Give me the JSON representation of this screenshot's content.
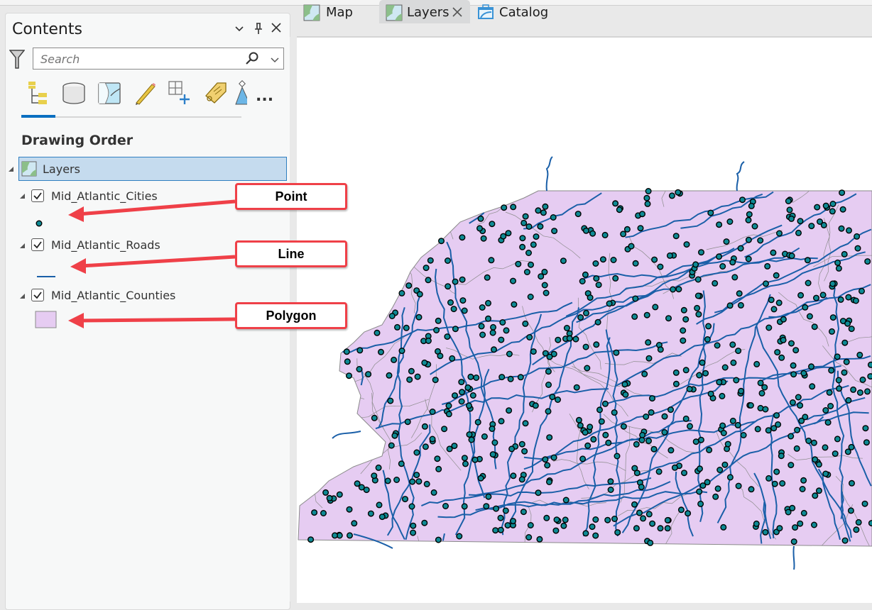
{
  "contents_pane": {
    "title": "Contents",
    "controls": {
      "options": "⌄",
      "pin": "pin",
      "close": "✕"
    },
    "search": {
      "placeholder": "Search",
      "value": ""
    },
    "toolbar": [
      {
        "icon": "list-by-drawing-order-icon",
        "selected": true
      },
      {
        "icon": "list-by-data-source-icon"
      },
      {
        "icon": "list-by-selection-icon"
      },
      {
        "icon": "list-by-editing-icon"
      },
      {
        "icon": "list-by-snapping-icon"
      },
      {
        "icon": "list-by-labeling-icon"
      },
      {
        "icon": "list-by-perspective-imagery-icon"
      },
      {
        "icon": "more-icon",
        "label": "..."
      }
    ],
    "heading": "Drawing Order",
    "map_frame": {
      "name": "Layers",
      "selected": true
    },
    "layers": [
      {
        "name": "Mid_Atlantic_Cities",
        "checked": true,
        "symbol": "point",
        "symbol_color": "#0e8a94"
      },
      {
        "name": "Mid_Atlantic_Roads",
        "checked": true,
        "symbol": "line",
        "symbol_color": "#1a5fa8"
      },
      {
        "name": "Mid_Atlantic_Counties",
        "checked": true,
        "symbol": "polygon",
        "symbol_color": "#e6ccf2"
      }
    ]
  },
  "callouts": [
    {
      "label": "Point"
    },
    {
      "label": "Line"
    },
    {
      "label": "Polygon"
    }
  ],
  "tabs": [
    {
      "label": "Map",
      "icon": "map-icon",
      "active": false
    },
    {
      "label": "Layers",
      "icon": "map-icon",
      "active": true,
      "closable": true
    },
    {
      "label": "Catalog",
      "icon": "catalog-icon",
      "active": false
    }
  ],
  "map": {
    "polygon_fill": "#e6ccf2",
    "polygon_outline": "#8a8a8a",
    "road_color": "#1a5fa8",
    "city_fill": "#0e8a94",
    "city_outline": "#000000"
  },
  "colors": {
    "accent": "#0a6fc0",
    "selection": "#c5dbee",
    "callout_border": "#ef4048"
  }
}
